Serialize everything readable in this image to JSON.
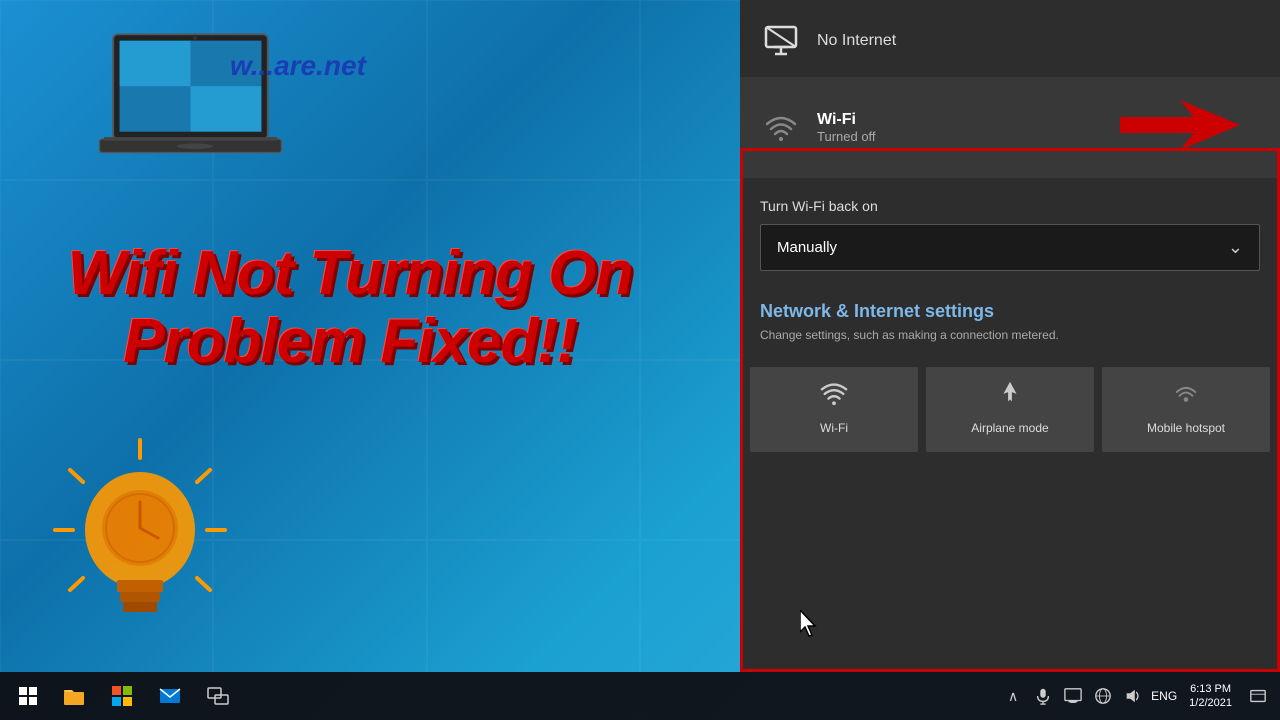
{
  "desktop": {
    "background_color": "#1a8fd1"
  },
  "laptop_area": {
    "website_url": "w...are.net"
  },
  "title": {
    "line1": "Wifi Not Turning On",
    "line2": "Problem Fixed!!"
  },
  "network_panel": {
    "no_internet_label": "No Internet",
    "wifi_section": {
      "name": "Wi-Fi",
      "status": "Turned off"
    },
    "turn_wifi_label": "Turn Wi-Fi back on",
    "dropdown": {
      "value": "Manually",
      "chevron": "⌄"
    },
    "settings": {
      "title": "Network & Internet settings",
      "description": "Change settings, such as making a connection metered."
    },
    "quick_actions": [
      {
        "label": "Wi-Fi",
        "icon": "wifi"
      },
      {
        "label": "Airplane mode",
        "icon": "airplane"
      },
      {
        "label": "Mobile hotspot",
        "icon": "hotspot"
      }
    ]
  },
  "taskbar": {
    "start_icon": "⊞",
    "items": [
      {
        "label": "File Explorer",
        "icon": "📁"
      },
      {
        "label": "Microsoft Store",
        "icon": "🛍"
      },
      {
        "label": "Mail",
        "icon": "✉"
      },
      {
        "label": "Task View",
        "icon": "❑"
      }
    ],
    "tray": {
      "chevron": "∧",
      "mic_icon": "🎤",
      "display_icon": "⬜",
      "globe_icon": "🌐",
      "volume_icon": "🔊",
      "lang": "ENG",
      "time": "6:13 PM",
      "date": "1/2/2021",
      "notification_icon": "💬"
    }
  }
}
